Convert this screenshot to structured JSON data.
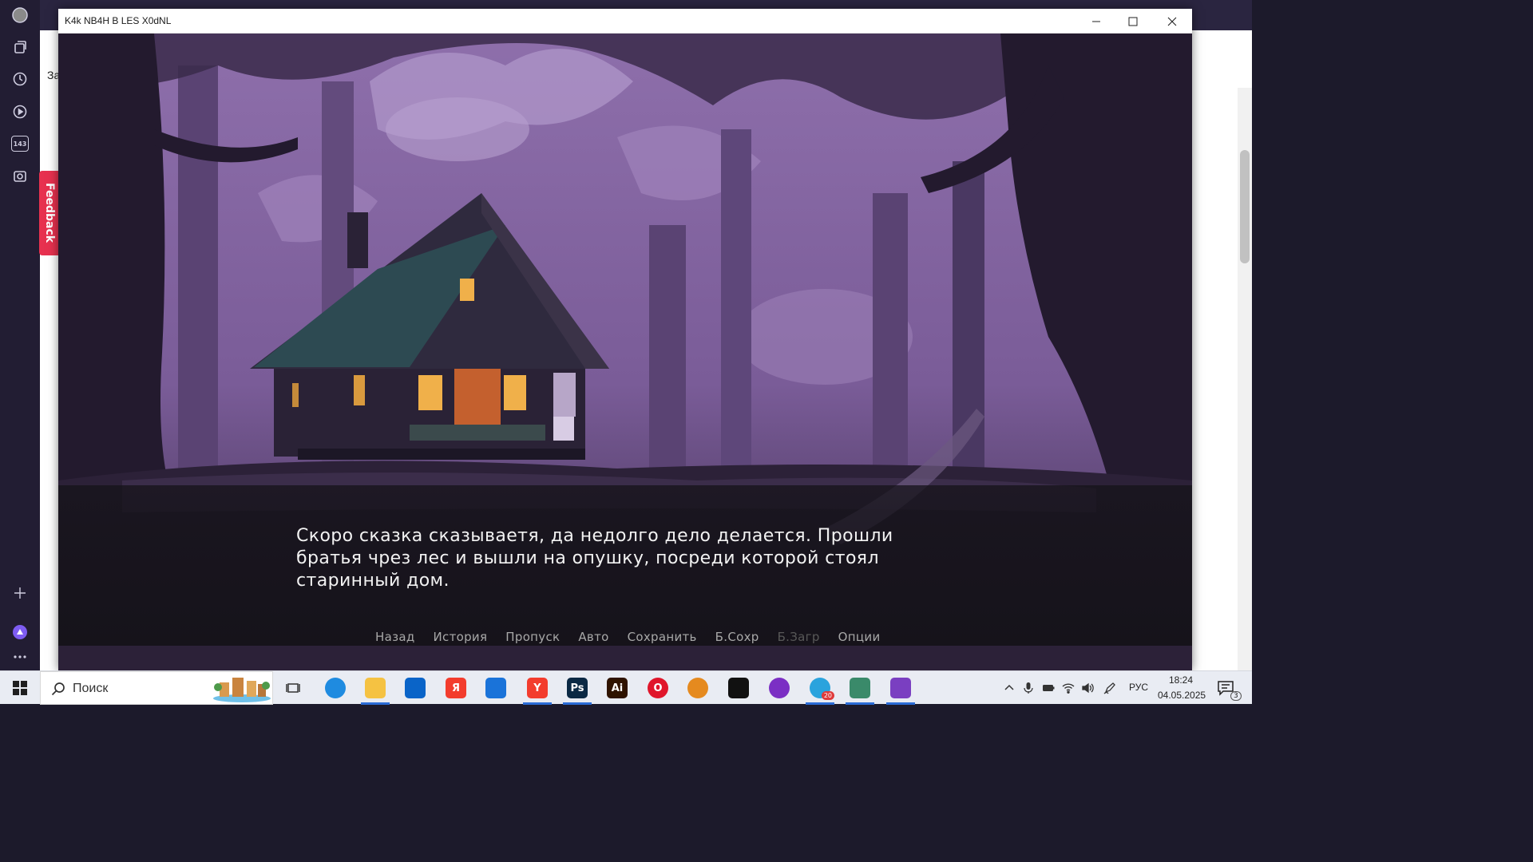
{
  "window": {
    "title": "K4k NB4H B LES X0dNL",
    "controls": {
      "minimize": "minimize",
      "maximize": "maximize",
      "close": "close"
    }
  },
  "browser": {
    "sidebar_counter": "143",
    "feedback_label": "Feedback",
    "left_text_fragment": "За"
  },
  "game": {
    "dialogue": "Скоро сказка сказываетя, да недолго дело делается. Прошли братья чрез лес и вышли на опушку, посреди которой стоял старинный дом.",
    "quick_menu": [
      {
        "label": "Назад",
        "enabled": true
      },
      {
        "label": "История",
        "enabled": true
      },
      {
        "label": "Пропуск",
        "enabled": true
      },
      {
        "label": "Авто",
        "enabled": true
      },
      {
        "label": "Сохранить",
        "enabled": true
      },
      {
        "label": "Б.Сохр",
        "enabled": true
      },
      {
        "label": "Б.Загр",
        "enabled": false
      },
      {
        "label": "Опции",
        "enabled": true
      }
    ]
  },
  "taskbar": {
    "search_placeholder": "Поиск",
    "apps": [
      {
        "name": "task-view",
        "icon": "task-view-icon"
      },
      {
        "name": "edge",
        "icon": "edge-icon",
        "color": "#1f8be0"
      },
      {
        "name": "file-explorer",
        "icon": "folder-icon",
        "color": "#f5c242"
      },
      {
        "name": "outlook",
        "icon": "outlook-icon",
        "color": "#0a64c8"
      },
      {
        "name": "yandex",
        "icon": "yandex-icon",
        "label": "Я",
        "color": "#f33c2d"
      },
      {
        "name": "store",
        "icon": "store-icon",
        "color": "#1a73d9"
      },
      {
        "name": "yandex-browser",
        "icon": "yandex-browser-icon",
        "label": "Y",
        "color": "#f33c2d"
      },
      {
        "name": "photoshop",
        "icon": "photoshop-icon",
        "label": "Ps",
        "color": "#0b2944"
      },
      {
        "name": "illustrator",
        "icon": "illustrator-icon",
        "label": "Ai",
        "color": "#2f1300"
      },
      {
        "name": "opera",
        "icon": "opera-icon",
        "label": "O",
        "color": "#e0162b"
      },
      {
        "name": "fl-studio",
        "icon": "fl-studio-icon",
        "color": "#e58a1f"
      },
      {
        "name": "capcut",
        "icon": "capcut-icon",
        "color": "#111111"
      },
      {
        "name": "tor",
        "icon": "tor-icon",
        "color": "#7b2fc4"
      },
      {
        "name": "telegram",
        "icon": "telegram-icon",
        "color": "#2aa3dd",
        "badge": "20"
      },
      {
        "name": "notepad",
        "icon": "notepad-icon",
        "color": "#3a8a6a"
      },
      {
        "name": "game",
        "icon": "game-icon",
        "color": "#7a3fc1"
      }
    ],
    "tray": {
      "language": "РУС",
      "time": "18:24",
      "date": "04.05.2025",
      "notifications": "3"
    }
  },
  "colors": {
    "sky": "#8e6fab",
    "fog": "#a98fc3",
    "trees": "#3a2a4a",
    "window_light": "#f0b04a",
    "dialogue_text": "#f2f2f2",
    "menu_text": "#a8a8a8"
  }
}
